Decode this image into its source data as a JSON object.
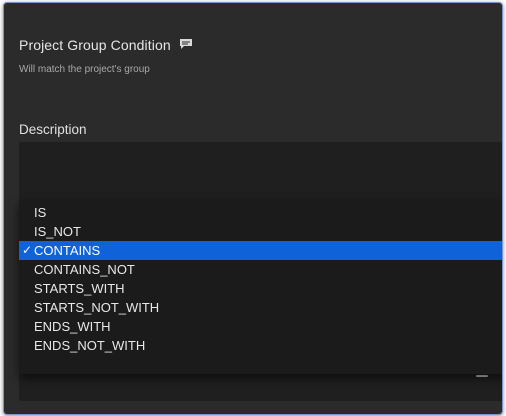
{
  "condition": {
    "title": "Project Group Condition",
    "subtitle": "Will match the project's group",
    "comment_icon": "comment-icon"
  },
  "description": {
    "label": "Description",
    "value": ""
  },
  "dropdown": {
    "selected": "CONTAINS",
    "check_glyph": "✓",
    "options": [
      {
        "label": "IS"
      },
      {
        "label": "IS_NOT"
      },
      {
        "label": "CONTAINS"
      },
      {
        "label": "CONTAINS_NOT"
      },
      {
        "label": "STARTS_WITH"
      },
      {
        "label": "STARTS_NOT_WITH"
      },
      {
        "label": "ENDS_WITH"
      },
      {
        "label": "ENDS_NOT_WITH"
      }
    ]
  },
  "colors": {
    "panel_bg": "#2b2b2b",
    "field_bg": "#1f1f1f",
    "selection": "#0f62d8"
  }
}
